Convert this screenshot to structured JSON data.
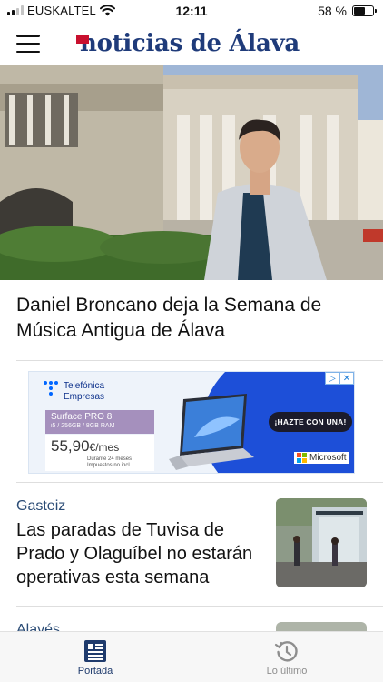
{
  "status_bar": {
    "carrier": "EUSKALTEL",
    "time": "12:11",
    "battery": "58 %",
    "battery_level": 0.58
  },
  "header": {
    "logo_text": "noticias de Álava",
    "menu_icon": "hamburger-menu-icon"
  },
  "hero": {
    "headline": "Daniel Broncano deja la Semana de Música Antigua de Álava"
  },
  "ad": {
    "brand_line1": "Telefónica",
    "brand_line2": "Empresas",
    "product_name": "Surface PRO 8",
    "product_spec": "i5 / 256GB / 8GB RAM",
    "price": "55,90",
    "price_unit": "€/mes",
    "terms_line1": "Durante 24 meses",
    "terms_line2": "Impuestos no incl.",
    "cta": "¡HAZTE CON UNA!",
    "advertiser": "Microsoft",
    "colors": {
      "blue": "#1d4fd8",
      "purple": "#a590bd",
      "cta": "#1b1b2b"
    }
  },
  "articles": [
    {
      "section": "Gasteiz",
      "title": "Las paradas de Tuvisa de Prado y Olaguíbel no estarán operativas esta semana"
    },
    {
      "section": "Alavés",
      "title": ""
    }
  ],
  "tab_bar": {
    "tabs": [
      {
        "label": "Portada",
        "icon": "newspaper-icon",
        "active": true
      },
      {
        "label": "Lo último",
        "icon": "history-clock-icon",
        "active": false
      }
    ]
  },
  "colors": {
    "brand_blue": "#1f3b7a",
    "brand_red": "#c8102e",
    "section_label": "#2a4b75"
  }
}
